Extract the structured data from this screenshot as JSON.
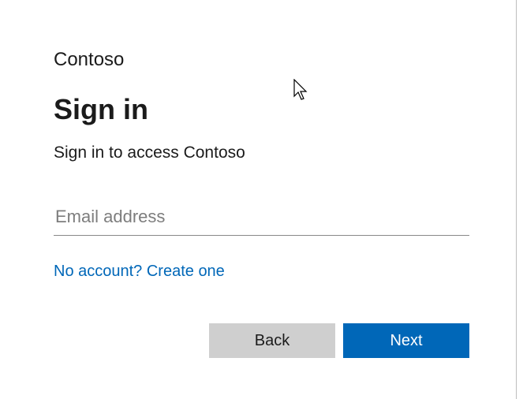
{
  "brand": "Contoso",
  "heading": "Sign in",
  "subtitle": "Sign in to access Contoso",
  "email": {
    "placeholder": "Email address",
    "value": ""
  },
  "createAccountLink": "No account? Create one",
  "buttons": {
    "back": "Back",
    "next": "Next"
  },
  "colors": {
    "primary": "#0067b8",
    "secondary": "#cfcfcf",
    "text": "#1b1b1b"
  }
}
